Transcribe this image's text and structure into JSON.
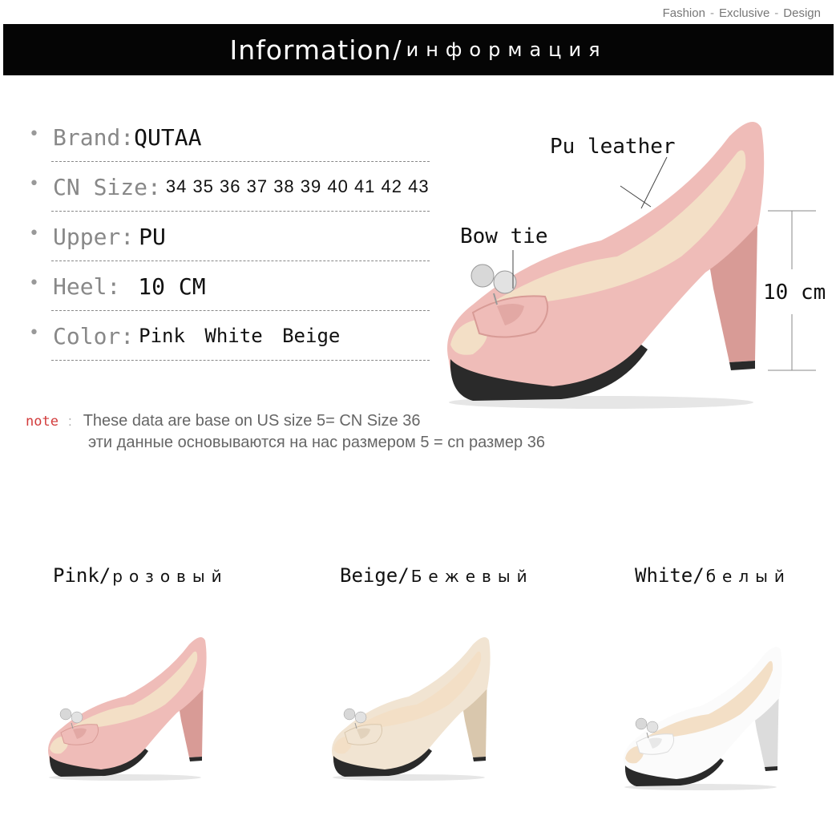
{
  "header": {
    "tagline": [
      "Fashion",
      "Exclusive",
      "Design"
    ],
    "tagline_sep": "-",
    "banner_en": "Information",
    "banner_sep": "/",
    "banner_ru": "информация"
  },
  "specs": [
    {
      "label": "Brand:",
      "value": "QUTAA"
    },
    {
      "label": "CN Size:",
      "value": "34 35 36 37 38 39 40 41 42 43"
    },
    {
      "label": "Upper:",
      "value": "PU"
    },
    {
      "label": "Heel:",
      "value": "10 CM"
    },
    {
      "label": "Color:",
      "value": "Pink  White  Beige"
    }
  ],
  "note": {
    "label": "note",
    "colon": ":",
    "line1": "These data are base on US size 5= CN Size 36",
    "line2": "эти данные основываются на нас размером 5 = cn размер 36"
  },
  "callouts": {
    "material": "Pu leather",
    "bow": "Bow tie",
    "heel": "10 cm"
  },
  "colors": [
    {
      "en": "Pink",
      "sep": "/",
      "ru": "розовый",
      "fill": "#efbcb8",
      "shade": "#d89b96"
    },
    {
      "en": "Beige",
      "sep": "/",
      "ru": "Бежевый",
      "fill": "#f1e4d2",
      "shade": "#d9c7ad"
    },
    {
      "en": "White",
      "sep": "/",
      "ru": "белый",
      "fill": "#fbfbfb",
      "shade": "#dcdcdc"
    }
  ],
  "main_shoe": {
    "fill": "#efbcb8",
    "shade": "#d89b96",
    "lining": "#f3dfc6",
    "sole": "#2a2a2a"
  },
  "bullet_char": "•"
}
